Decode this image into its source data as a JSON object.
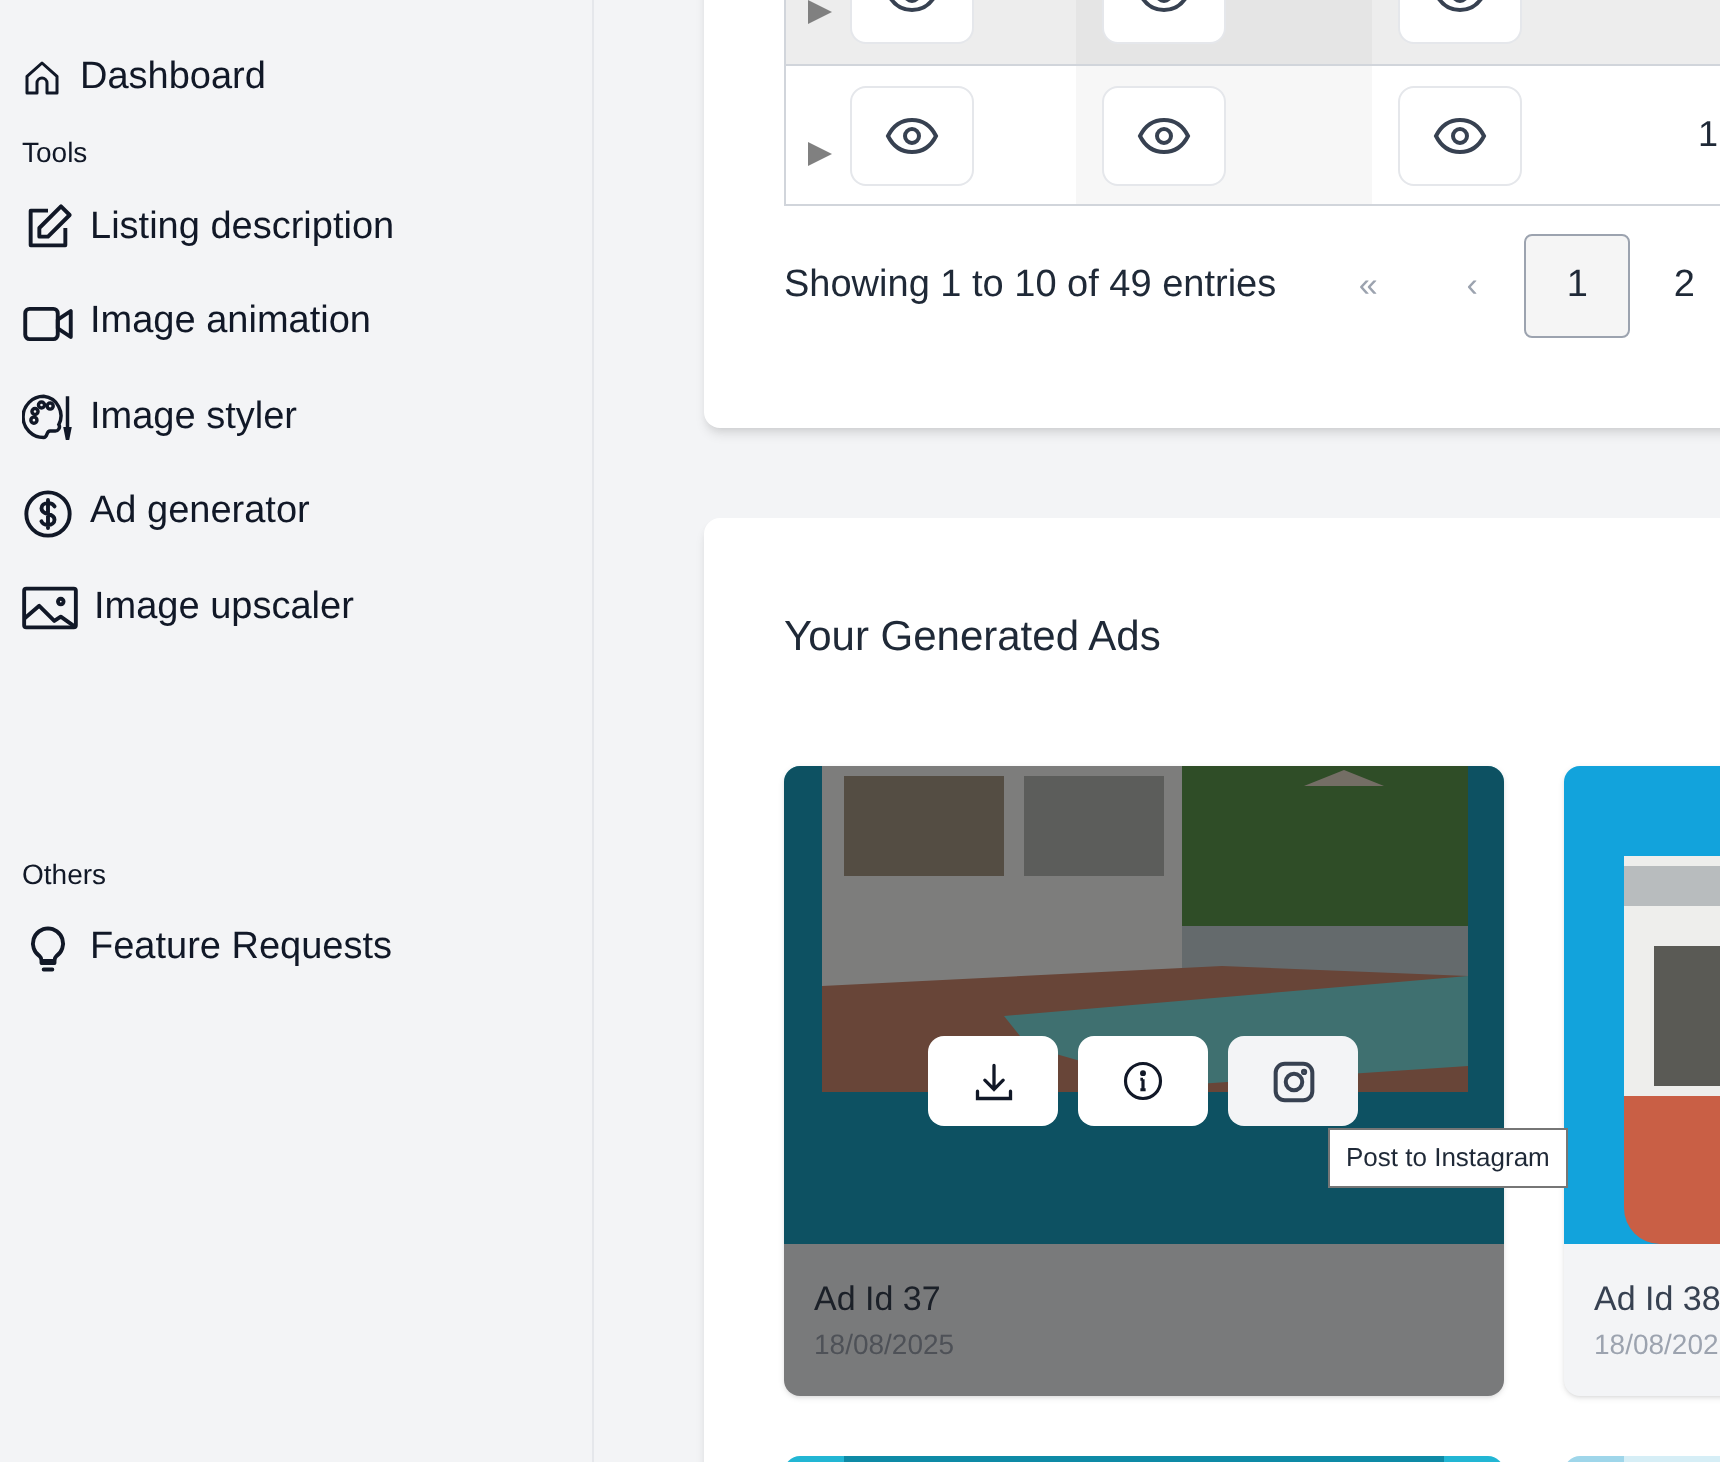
{
  "sidebar": {
    "items": [
      {
        "kind": "link",
        "label": "Dashboard"
      },
      {
        "kind": "heading",
        "label": "Tools"
      },
      {
        "kind": "link",
        "label": "Listing description"
      },
      {
        "kind": "link",
        "label": "Image animation"
      },
      {
        "kind": "link",
        "label": "Image styler"
      },
      {
        "kind": "link",
        "label": "Ad generator"
      },
      {
        "kind": "link",
        "label": "Image upscaler"
      },
      {
        "kind": "spacer"
      },
      {
        "kind": "heading",
        "label": "Others"
      },
      {
        "kind": "link",
        "label": "Feature Requests"
      }
    ]
  },
  "table": {
    "rows": [
      {
        "highlighted": true,
        "column_4": ""
      },
      {
        "highlighted": false,
        "column_4": "1"
      }
    ]
  },
  "pagination": {
    "summary": "Showing 1 to 10 of 49 entries",
    "buttons": [
      {
        "label": "«",
        "selected": false
      },
      {
        "label": "‹",
        "selected": false
      },
      {
        "label": "1",
        "selected": true
      },
      {
        "label": "2",
        "selected": false
      }
    ]
  },
  "ads": {
    "title": "Your Generated Ads",
    "items": [
      {
        "kind": "ad",
        "title": "Ad Id 37",
        "date": "18/08/2025",
        "hovered": true,
        "tooltip": "Post to Instagram"
      },
      {
        "kind": "ad",
        "title": "Ad Id 38",
        "date": "18/08/202",
        "hovered": false
      },
      {
        "kind": "picture"
      },
      {
        "kind": "picture"
      }
    ]
  }
}
